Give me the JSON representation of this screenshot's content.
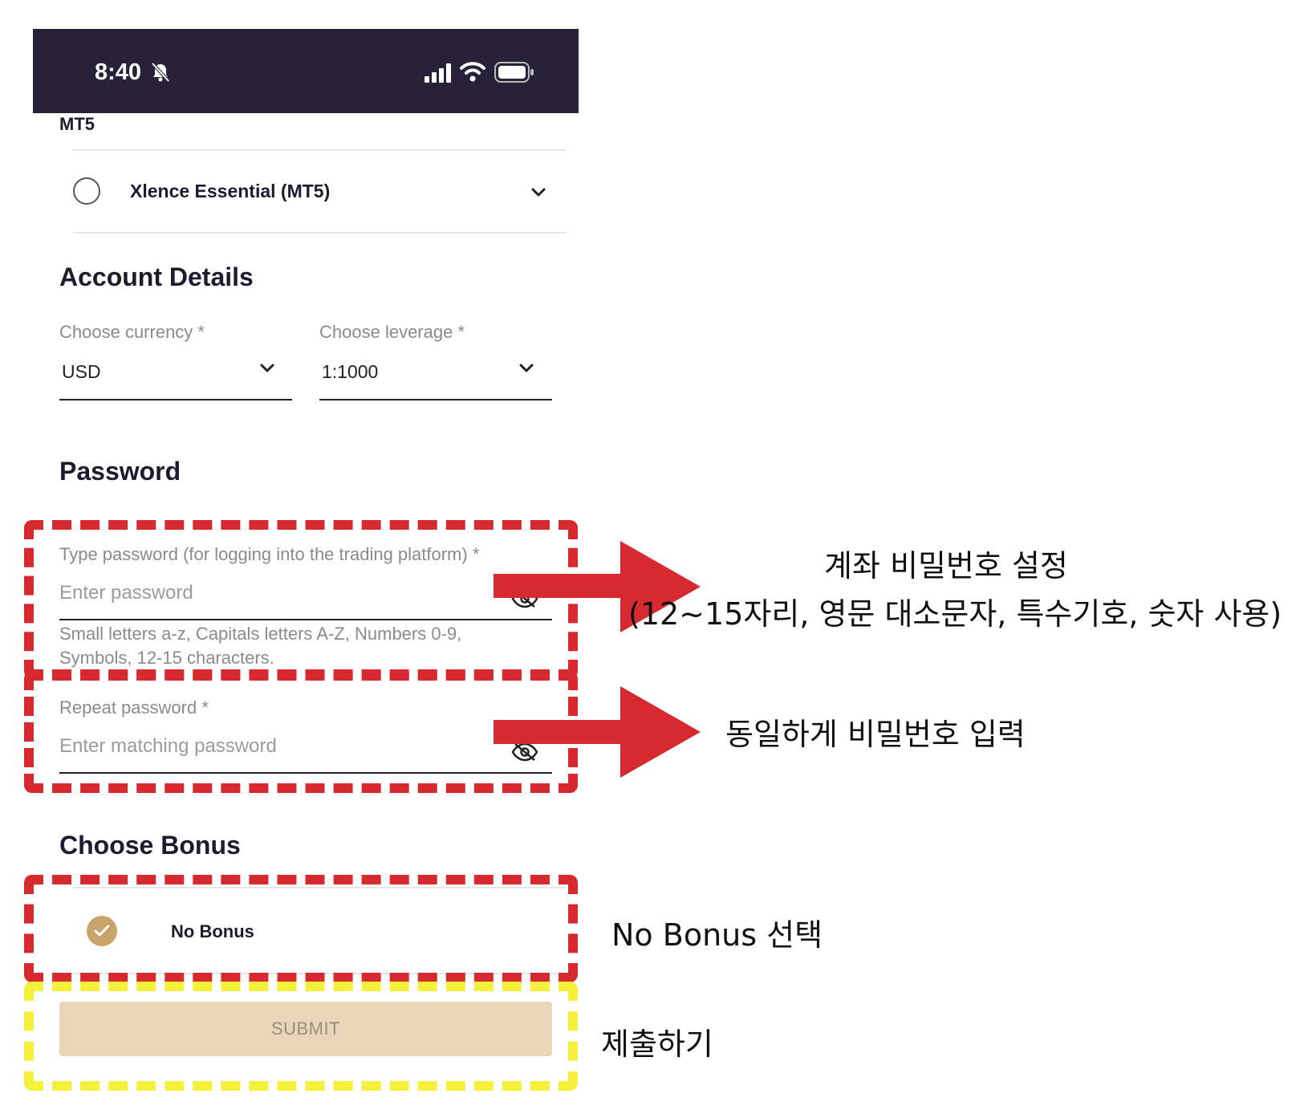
{
  "status_bar": {
    "time": "8:40"
  },
  "platform_label": "MT5",
  "account_type": {
    "label": "Xlence Essential (MT5)"
  },
  "account_details": {
    "title": "Account Details",
    "currency": {
      "label": "Choose currency *",
      "value": "USD"
    },
    "leverage": {
      "label": "Choose leverage *",
      "value": "1:1000"
    }
  },
  "password": {
    "title": "Password",
    "type": {
      "label": "Type password (for logging into the trading platform) *",
      "placeholder": "Enter password",
      "hint": "Small letters a-z, Capitals letters A-Z, Numbers 0-9, Symbols, 12-15 characters."
    },
    "repeat": {
      "label": "Repeat password *",
      "placeholder": "Enter matching password"
    }
  },
  "bonus": {
    "title": "Choose Bonus",
    "option": "No Bonus"
  },
  "submit_label": "SUBMIT",
  "annotations": {
    "password_setup_line1": "계좌 비밀번호 설정",
    "password_setup_line2": "(12~15자리, 영문 대소문자, 특수기호, 숫자 사용)",
    "repeat_password": "동일하게 비밀번호 입력",
    "bonus": "No Bonus 선택",
    "submit": "제출하기"
  },
  "colors": {
    "status_bar": "#27213a",
    "accent": "#c9a46a",
    "submit_bg": "#ead6b7",
    "annotation_red": "#d62a30",
    "annotation_yellow": "#f5f03a"
  }
}
